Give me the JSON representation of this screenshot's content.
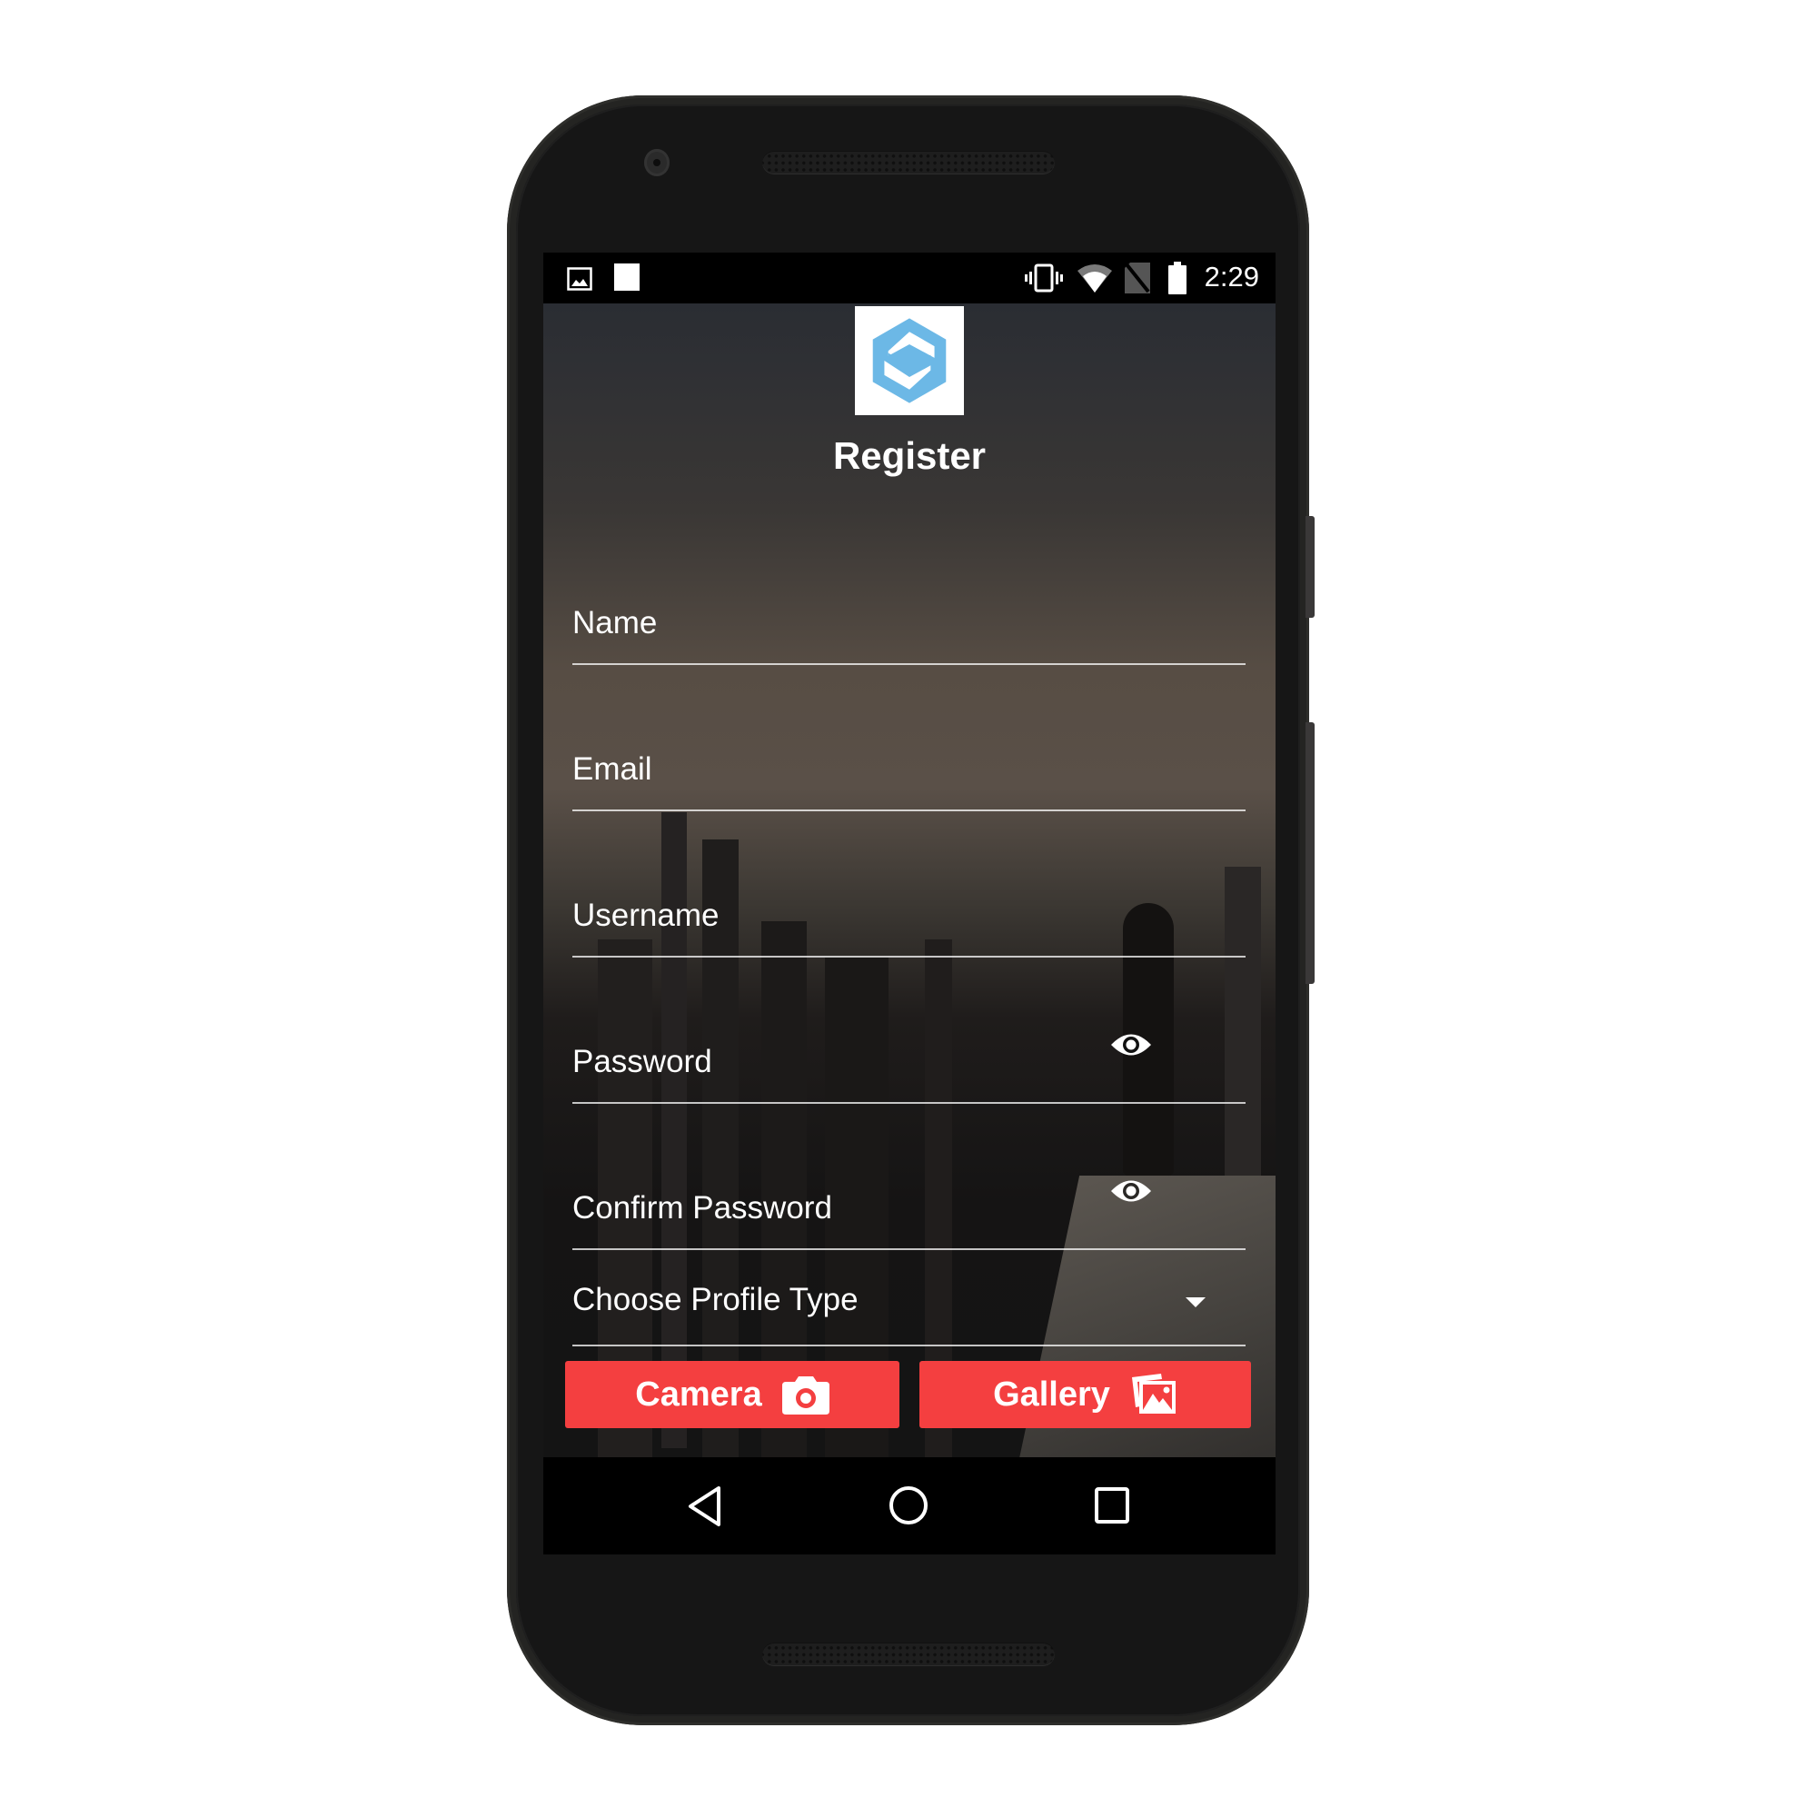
{
  "status_bar": {
    "time": "2:29",
    "left_icons": [
      "image-notification-icon",
      "square-notification-icon"
    ],
    "right_icons": [
      "vibrate-icon",
      "wifi-icon",
      "no-sim-icon",
      "battery-icon"
    ]
  },
  "app": {
    "logo_icon": "hexagon-s-logo",
    "title": "Register",
    "accent_color": "#f43f40",
    "logo_color": "#6cb8e6"
  },
  "form": {
    "fields": [
      {
        "label": "Name",
        "type": "text"
      },
      {
        "label": "Email",
        "type": "email"
      },
      {
        "label": "Username",
        "type": "text"
      },
      {
        "label": "Password",
        "type": "password",
        "icon": "eye-icon"
      },
      {
        "label": "Confirm Password",
        "type": "password",
        "icon": "eye-icon"
      }
    ],
    "profile_select": {
      "label": "Choose Profile Type",
      "icon": "dropdown-arrow-icon"
    }
  },
  "buttons": {
    "camera": {
      "label": "Camera",
      "icon": "camera-icon"
    },
    "gallery": {
      "label": "Gallery",
      "icon": "gallery-icon"
    }
  },
  "nav_bar": {
    "icons": [
      "back-icon",
      "home-icon",
      "recents-icon"
    ]
  }
}
